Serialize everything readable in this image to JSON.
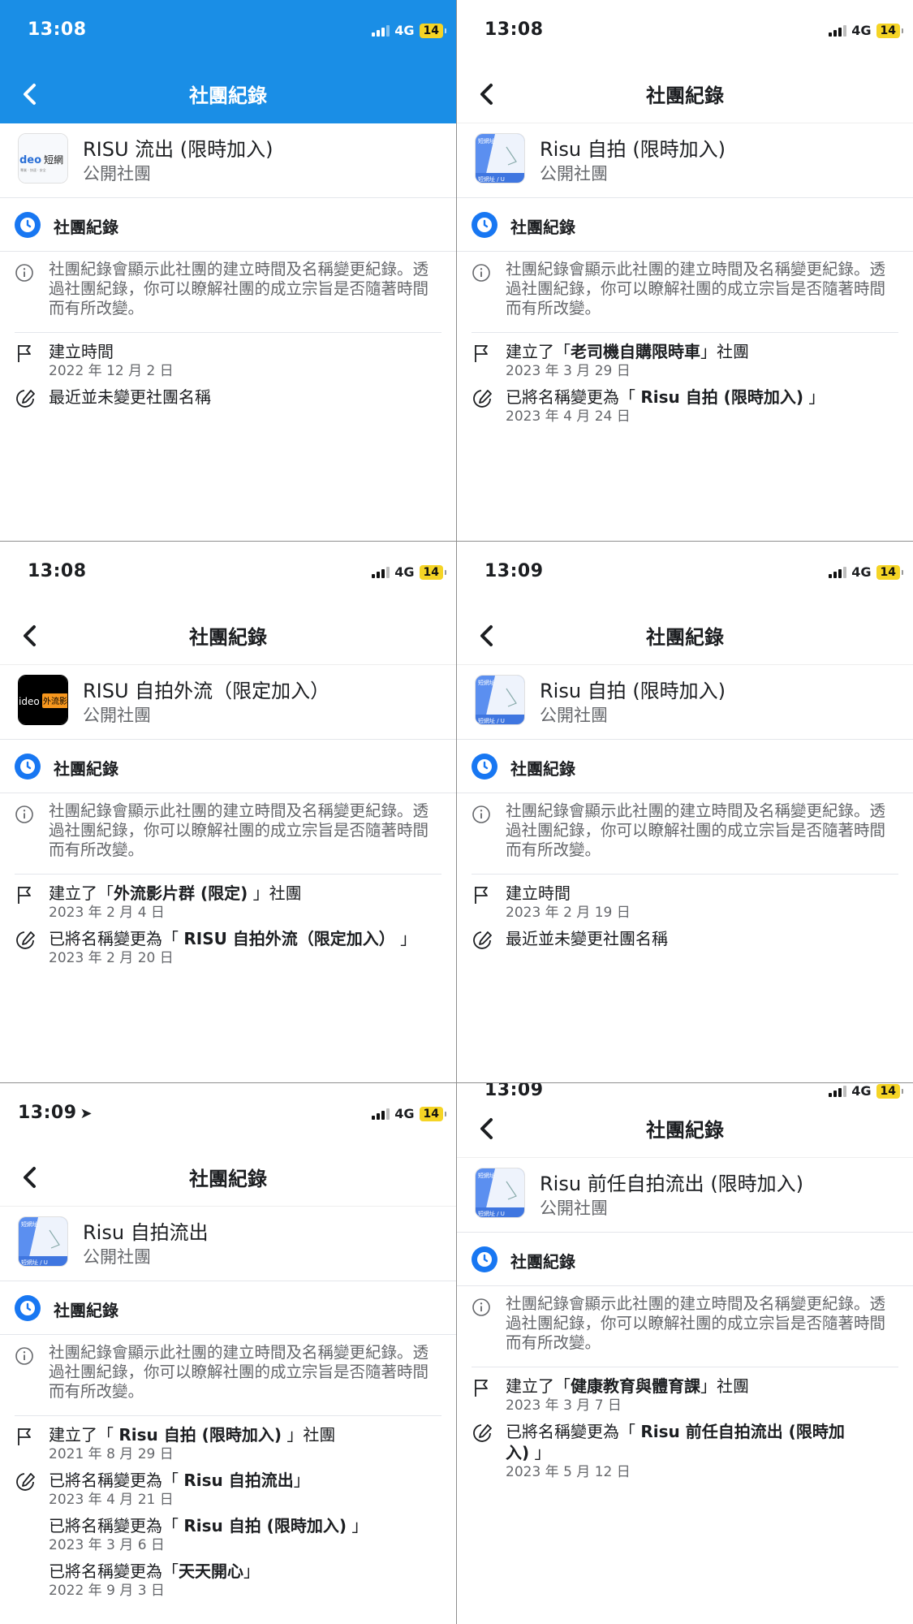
{
  "nav_title": "社團紀錄",
  "section_label": "社團紀錄",
  "group_type": "公開社團",
  "info_text": "社團紀錄會顯示此社團的建立時間及名稱變更紀錄。透過社團紀錄，你可以瞭解社團的成立宗旨是否隨著時間而有所改變。",
  "status": {
    "network": "4G",
    "battery": "14"
  },
  "colors": {
    "header_blue": "#1a8ee6",
    "section_icon_blue": "#1877f2",
    "battery_yellow": "#f5d425"
  },
  "avatar_text": {
    "a": {
      "left": "deo",
      "right": "短網",
      "sub": "專業 · 快速 · 安全"
    },
    "b": {
      "left": "ideo",
      "right": "外流影"
    },
    "c": {
      "top": "短網址",
      "bottom": "短網址 / U"
    }
  },
  "panels": [
    {
      "time": "13:08",
      "group_name": "RISU 流出 (限時加入)",
      "entries": [
        {
          "title_pre": "建立時間",
          "title_bold": "",
          "title_post": "",
          "date": "2022 年 12 月 2 日"
        },
        {
          "title_pre": "最近並未變更社團名稱",
          "title_bold": "",
          "title_post": "",
          "date": ""
        }
      ]
    },
    {
      "time": "13:08",
      "group_name": "Risu 自拍 (限時加入)",
      "entries": [
        {
          "title_pre": "建立了「",
          "title_bold": "老司機自購限時車",
          "title_post": "」社團",
          "date": "2023 年 3 月 29 日"
        },
        {
          "title_pre": "已將名稱變更為「 ",
          "title_bold": "Risu 自拍 (限時加入)",
          "title_post": " 」",
          "date": "2023 年 4 月 24 日"
        }
      ]
    },
    {
      "time": "13:08",
      "group_name": "RISU 自拍外流（限定加入）",
      "entries": [
        {
          "title_pre": "建立了「",
          "title_bold": "外流影片群 (限定)",
          "title_post": " 」社團",
          "date": "2023 年 2 月 4 日"
        },
        {
          "title_pre": "已將名稱變更為「 ",
          "title_bold": "RISU 自拍外流（限定加入）",
          "title_post": " 」",
          "date": "2023 年 2 月 20 日"
        }
      ]
    },
    {
      "time": "13:09",
      "group_name": "Risu 自拍 (限時加入)",
      "entries": [
        {
          "title_pre": "建立時間",
          "title_bold": "",
          "title_post": "",
          "date": "2023 年 2 月 19 日"
        },
        {
          "title_pre": "最近並未變更社團名稱",
          "title_bold": "",
          "title_post": "",
          "date": ""
        }
      ]
    },
    {
      "time": "13:09",
      "group_name": "Risu 自拍流出",
      "entries": [
        {
          "title_pre": "建立了「 ",
          "title_bold": "Risu 自拍 (限時加入)",
          "title_post": " 」社團",
          "date": "2021 年 8 月 29 日"
        },
        {
          "title_pre": "已將名稱變更為「 ",
          "title_bold": "Risu 自拍流出",
          "title_post": "」",
          "date": "2023 年 4 月 21 日"
        },
        {
          "title_pre": "已將名稱變更為「 ",
          "title_bold": "Risu 自拍 (限時加入)",
          "title_post": " 」",
          "date": "2023 年 3 月 6 日"
        },
        {
          "title_pre": "已將名稱變更為「",
          "title_bold": "天天開心",
          "title_post": "」",
          "date": "2022 年 9 月 3 日"
        }
      ]
    },
    {
      "time": "13:09",
      "group_name": "Risu 前任自拍流出 (限時加入)",
      "entries": [
        {
          "title_pre": "建立了「",
          "title_bold": "健康教育與體育課",
          "title_post": "」社團",
          "date": "2023 年 3 月 7 日"
        },
        {
          "title_pre": "已將名稱變更為「 ",
          "title_bold": "Risu 前任自拍流出 (限時加入)",
          "title_post": " 」",
          "date": "2023 年 5 月 12 日"
        }
      ]
    }
  ]
}
